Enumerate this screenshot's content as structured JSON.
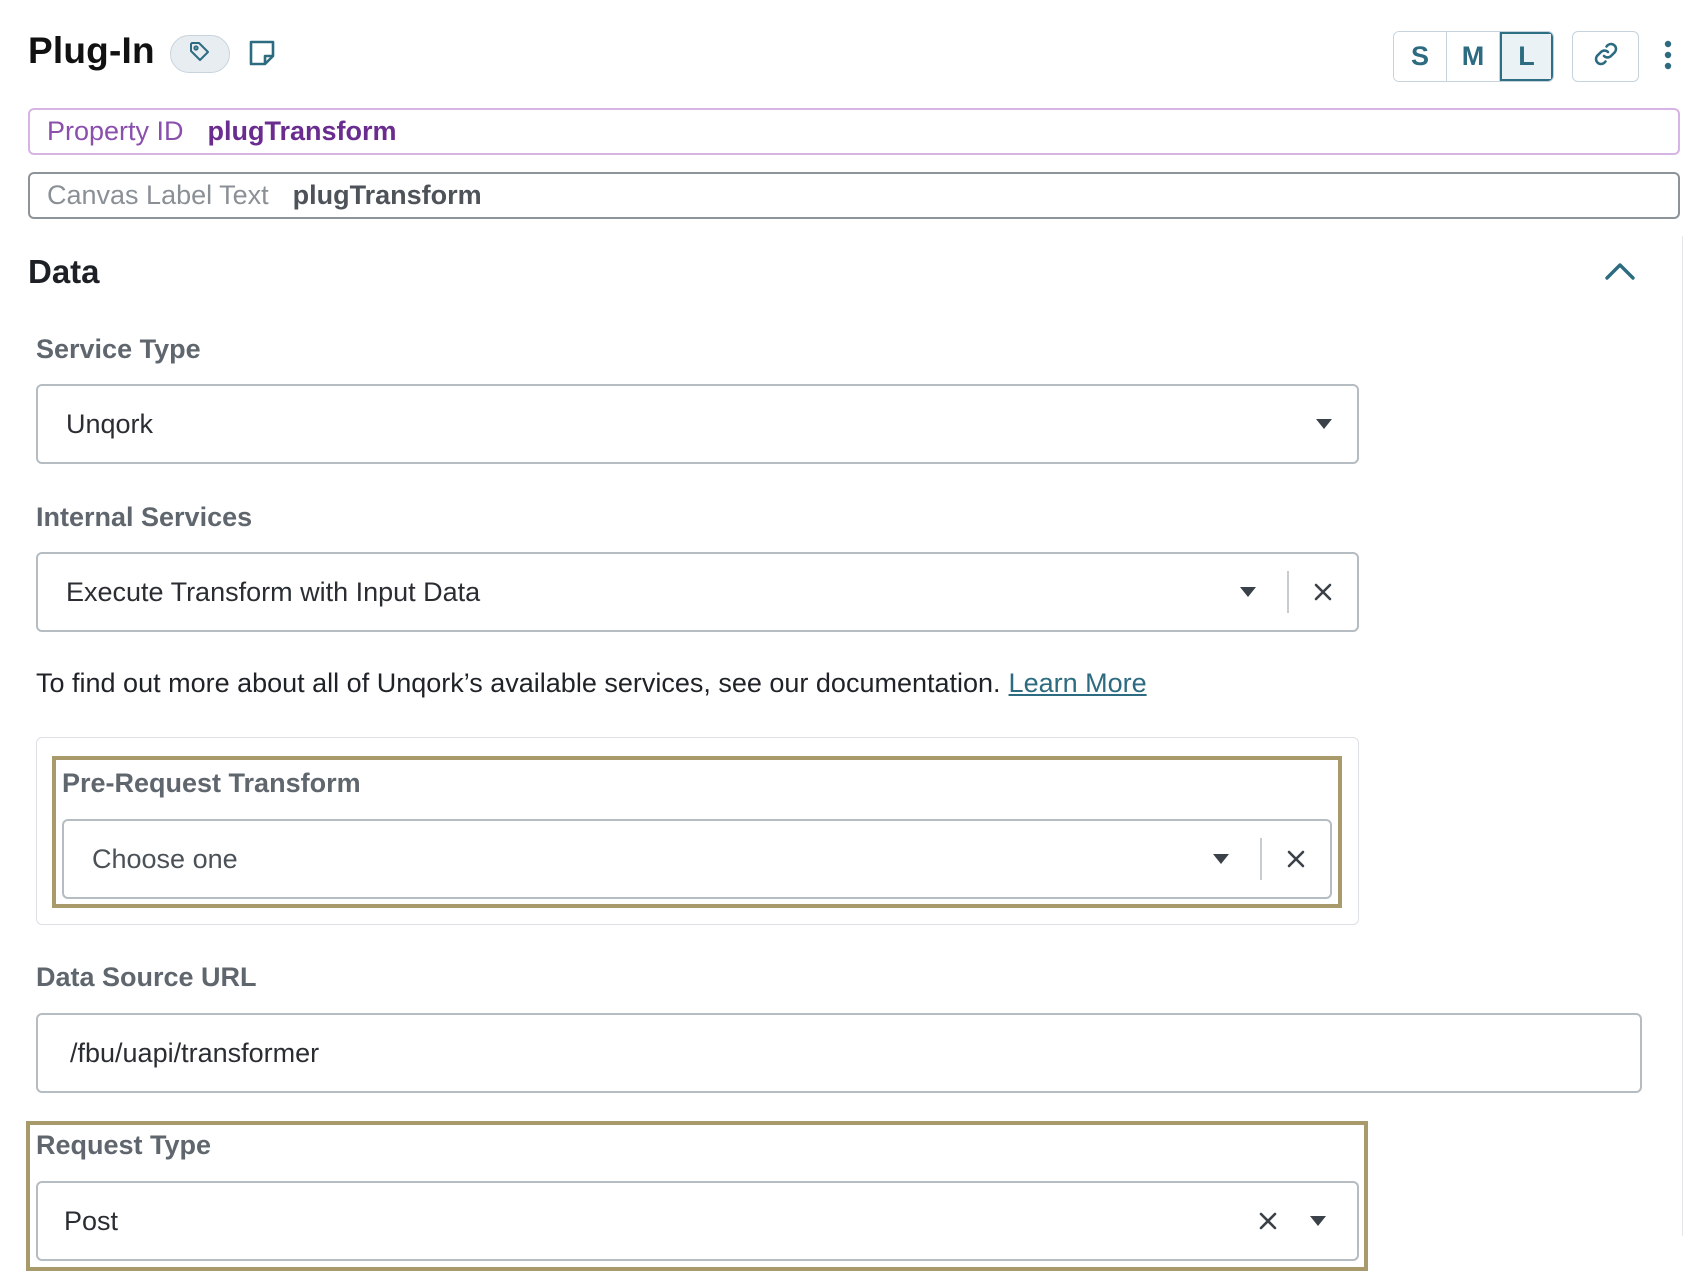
{
  "header": {
    "title": "Plug-In",
    "sizes": [
      "S",
      "M",
      "L"
    ],
    "active_size": "L"
  },
  "property_id": {
    "label": "Property ID",
    "value": "plugTransform"
  },
  "canvas_label": {
    "label": "Canvas Label Text",
    "value": "plugTransform"
  },
  "section": {
    "title": "Data"
  },
  "service_type": {
    "label": "Service Type",
    "value": "Unqork"
  },
  "internal_services": {
    "label": "Internal Services",
    "value": "Execute Transform with Input Data"
  },
  "help": {
    "text": "To find out more about all of Unqork’s available services, see our documentation.",
    "link": "Learn More"
  },
  "pre_request": {
    "label": "Pre-Request Transform",
    "placeholder": "Choose one"
  },
  "data_source": {
    "label": "Data Source URL",
    "value": "/fbu/uapi/transformer"
  },
  "request_type": {
    "label": "Request Type",
    "value": "Post"
  },
  "colors": {
    "accent": "#2c6b80",
    "property_border": "#d6b4e4",
    "property_text": "#6a2c8f",
    "highlight": "#a99a6b"
  },
  "icons": [
    "tag-icon",
    "note-icon",
    "link-icon",
    "kebab-icon",
    "chevron-up-icon",
    "caret-down-icon",
    "close-icon"
  ]
}
